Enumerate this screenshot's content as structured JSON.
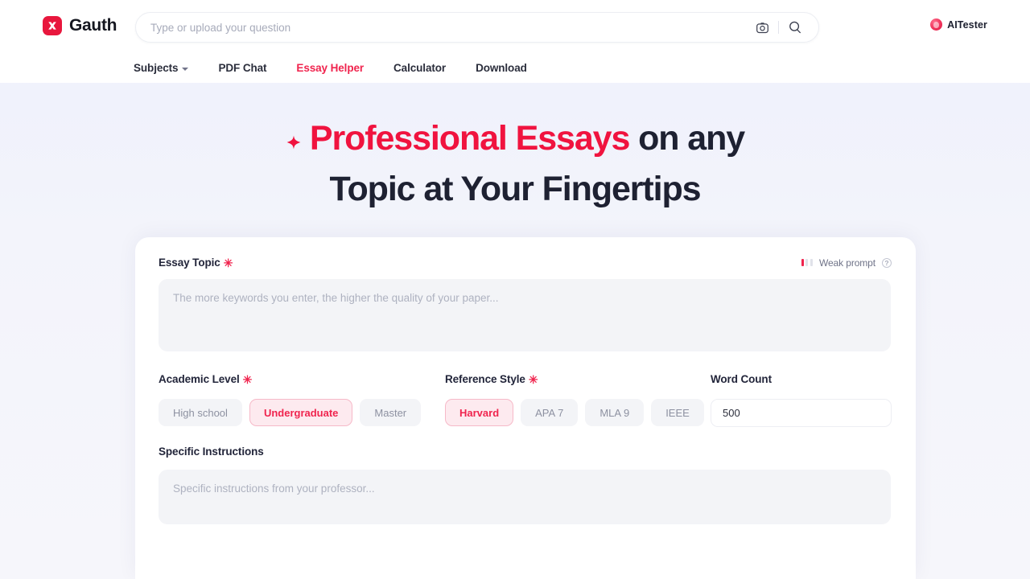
{
  "brand": {
    "name": "Gauth",
    "logo_icon": "gauth-x-logo-icon",
    "logo_color": "#e8173d"
  },
  "search": {
    "placeholder": "Type or upload your question",
    "value": "",
    "camera_icon": "camera-icon",
    "search_icon": "search-icon"
  },
  "account": {
    "name": "AITester",
    "avatar_icon": "user-avatar-icon"
  },
  "nav": {
    "items": [
      {
        "label": "Subjects",
        "active": false,
        "has_chevron": true
      },
      {
        "label": "PDF Chat",
        "active": false,
        "has_chevron": false
      },
      {
        "label": "Essay Helper",
        "active": true,
        "has_chevron": false
      },
      {
        "label": "Calculator",
        "active": false,
        "has_chevron": false
      },
      {
        "label": "Download",
        "active": false,
        "has_chevron": false
      }
    ]
  },
  "hero": {
    "sparkle_icon": "sparkle-icon",
    "line1_accent": "Professional Essays",
    "line1_rest": " on any",
    "line2": "Topic at Your Fingertips",
    "accent_color": "#f0133f",
    "text_color": "#1e2132"
  },
  "form": {
    "essay_topic": {
      "label": "Essay Topic",
      "required_marker": "✳",
      "placeholder": "The more keywords you enter, the higher the quality of your paper...",
      "value": ""
    },
    "prompt_strength": {
      "text": "Weak prompt",
      "filled_bars": 1,
      "total_bars": 3,
      "filled_color": "#f0244e",
      "empty_color": "#e0e2ea",
      "help_icon": "help-question-icon",
      "help_glyph": "?"
    },
    "academic_level": {
      "label": "Academic Level",
      "required_marker": "✳",
      "options": [
        {
          "label": "High school",
          "selected": false
        },
        {
          "label": "Undergraduate",
          "selected": true
        },
        {
          "label": "Master",
          "selected": false
        }
      ]
    },
    "reference_style": {
      "label": "Reference Style",
      "required_marker": "✳",
      "options": [
        {
          "label": "Harvard",
          "selected": true
        },
        {
          "label": "APA 7",
          "selected": false
        },
        {
          "label": "MLA 9",
          "selected": false
        },
        {
          "label": "IEEE",
          "selected": false
        }
      ]
    },
    "word_count": {
      "label": "Word Count",
      "value": "500",
      "placeholder": "500"
    },
    "specific_instructions": {
      "label": "Specific Instructions",
      "placeholder": "Specific instructions from your professor...",
      "value": ""
    }
  }
}
